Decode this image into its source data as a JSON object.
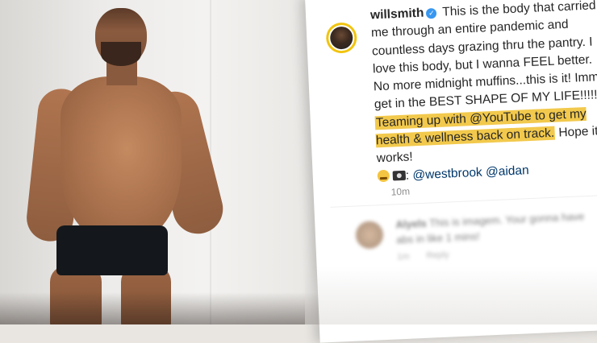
{
  "post": {
    "username": "willsmith",
    "verified_symbol": "✓",
    "caption_intro": "This is the body that carried me through an entire pandemic and countless days grazing thru the pantry. I love this body, but I wanna FEEL better. No more midnight muffins...this is it! Imma get in the BEST SHAPE OF MY LIFE!!!!! ",
    "caption_highlight": "Teaming up with @YouTube to get my health & wellness back on track.",
    "caption_after": " Hope it works!",
    "photo_credit_prefix": ":",
    "mentions": [
      "@westbrook",
      "@aidan"
    ],
    "timestamp": "10m",
    "highlight_color": "#f2c94c",
    "verified_color": "#3897f0"
  },
  "comment": {
    "username": "Alyels",
    "text": "This is imagem. Your gonna have abs in like 1 mins!",
    "meta": [
      "1m",
      "Reply"
    ]
  },
  "icons": {
    "emoji": "grimacing-face-icon",
    "camera": "camera-icon",
    "verified": "verified-badge-icon"
  }
}
